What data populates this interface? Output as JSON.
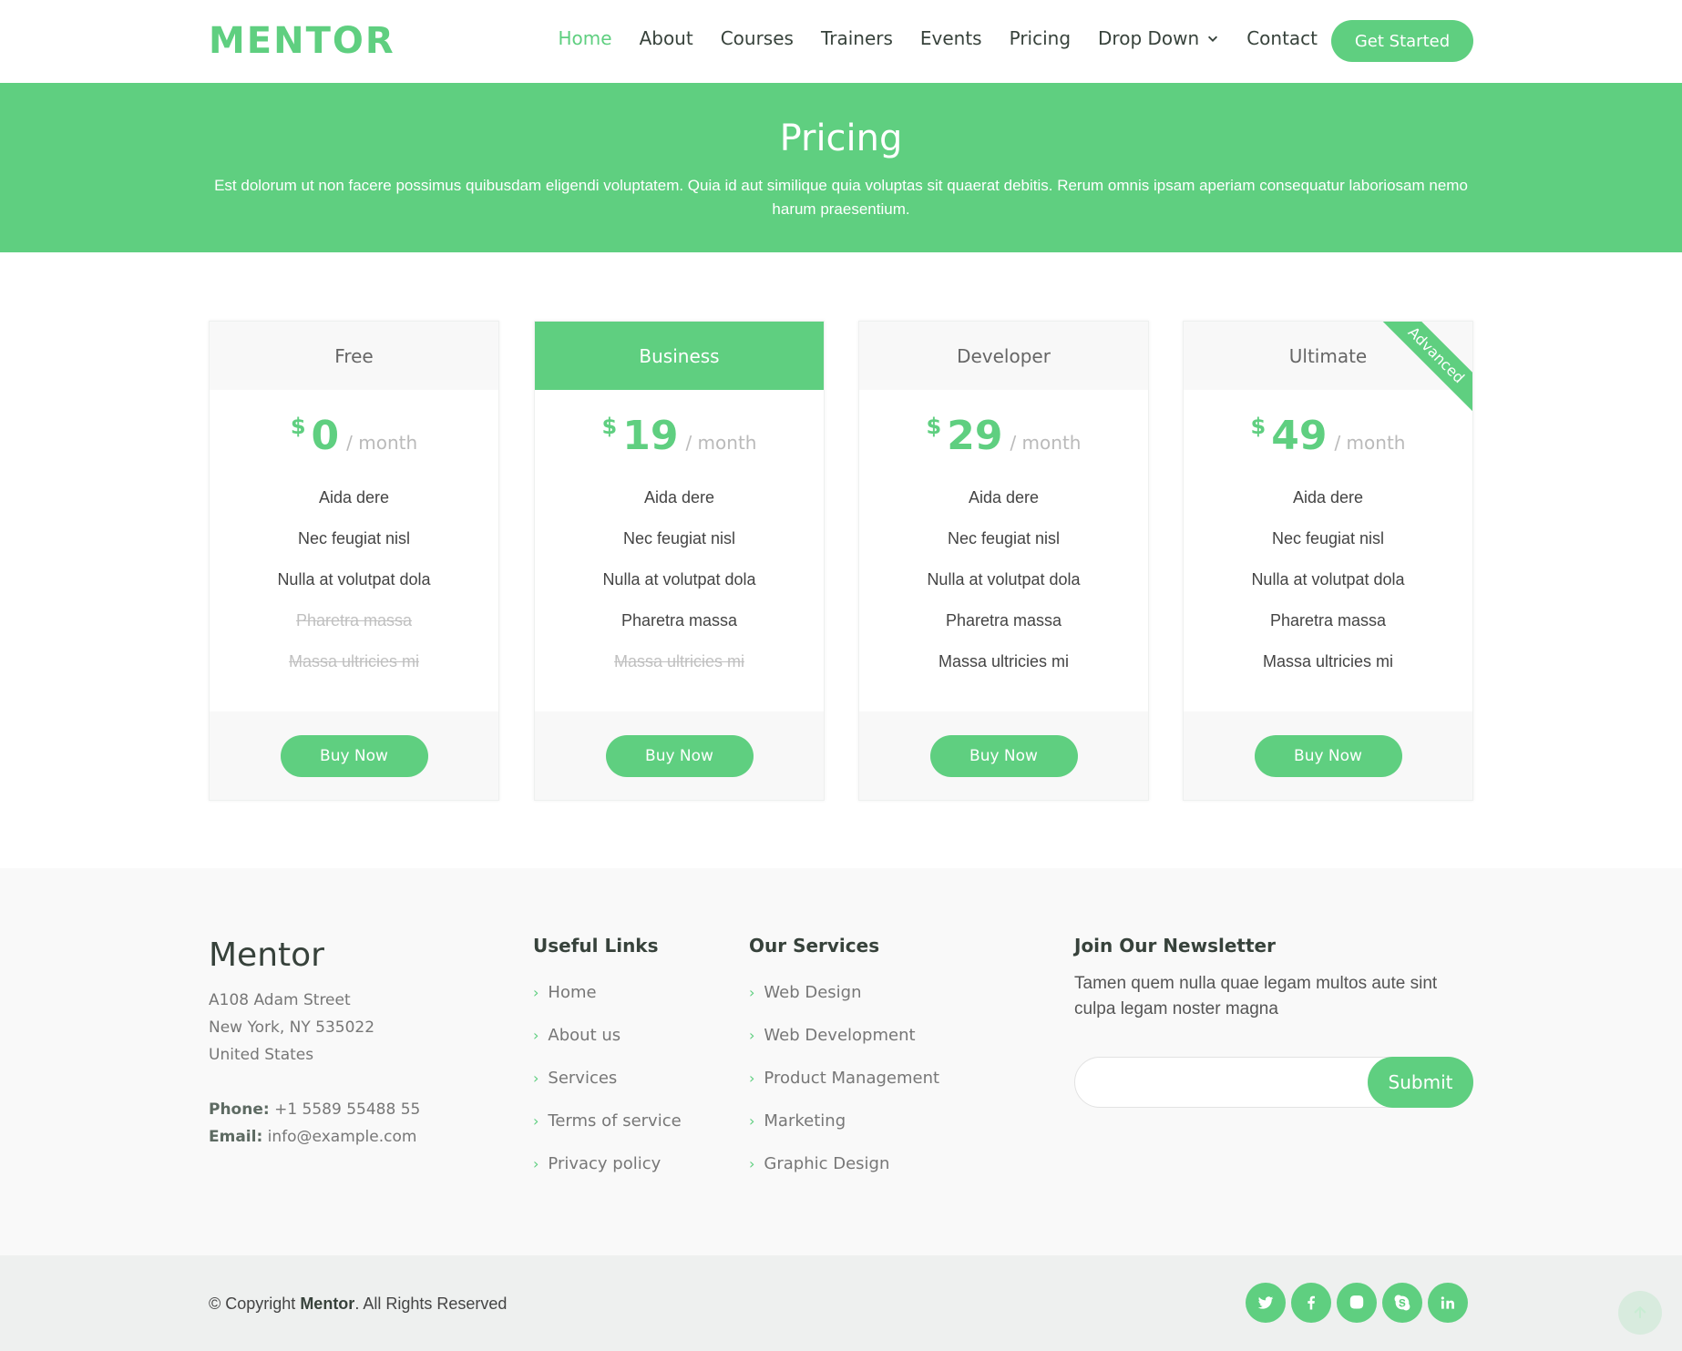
{
  "header": {
    "logo": "MENTOR",
    "nav": [
      "Home",
      "About",
      "Courses",
      "Trainers",
      "Events",
      "Pricing",
      "Drop Down",
      "Contact"
    ],
    "cta": "Get Started"
  },
  "hero": {
    "title": "Pricing",
    "text": "Est dolorum ut non facere possimus quibusdam eligendi voluptatem. Quia id aut similique quia voluptas sit quaerat debitis. Rerum omnis ipsam aperiam consequatur laboriosam nemo harum praesentium."
  },
  "plans": [
    {
      "name": "Free",
      "currency": "$",
      "amount": "0",
      "period": "/ month",
      "button": "Buy Now",
      "features": [
        "Aida dere",
        "Nec feugiat nisl",
        "Nulla at volutpat dola",
        "Pharetra massa",
        "Massa ultricies mi"
      ]
    },
    {
      "name": "Business",
      "currency": "$",
      "amount": "19",
      "period": "/ month",
      "button": "Buy Now",
      "features": [
        "Aida dere",
        "Nec feugiat nisl",
        "Nulla at volutpat dola",
        "Pharetra massa",
        "Massa ultricies mi"
      ]
    },
    {
      "name": "Developer",
      "currency": "$",
      "amount": "29",
      "period": "/ month",
      "button": "Buy Now",
      "features": [
        "Aida dere",
        "Nec feugiat nisl",
        "Nulla at volutpat dola",
        "Pharetra massa",
        "Massa ultricies mi"
      ]
    },
    {
      "name": "Ultimate",
      "currency": "$",
      "amount": "49",
      "period": "/ month",
      "button": "Buy Now",
      "ribbon": "Advanced",
      "features": [
        "Aida dere",
        "Nec feugiat nisl",
        "Nulla at volutpat dola",
        "Pharetra massa",
        "Massa ultricies mi"
      ]
    }
  ],
  "footer": {
    "brand": "Mentor",
    "address": [
      "A108 Adam Street",
      "New York, NY 535022",
      "United States"
    ],
    "phone_label": "Phone:",
    "phone": "+1 5589 55488 55",
    "email_label": "Email:",
    "email": "info@example.com",
    "links_title": "Useful Links",
    "links": [
      "Home",
      "About us",
      "Services",
      "Terms of service",
      "Privacy policy"
    ],
    "services_title": "Our Services",
    "services": [
      "Web Design",
      "Web Development",
      "Product Management",
      "Marketing",
      "Graphic Design"
    ],
    "newsletter_title": "Join Our Newsletter",
    "newsletter_text": "Tamen quem nulla quae legam multos aute sint culpa legam noster magna",
    "newsletter_placeholder": "",
    "submit": "Submit",
    "copyright_prefix": "© Copyright ",
    "copyright_brand": "Mentor",
    "copyright_suffix": ". All Rights Reserved",
    "socials": [
      "twitter-icon",
      "facebook-icon",
      "instagram-icon",
      "skype-icon",
      "linkedin-icon"
    ]
  },
  "colors": {
    "accent": "#5fcf80",
    "text": "#37423b",
    "muted": "#777777"
  }
}
